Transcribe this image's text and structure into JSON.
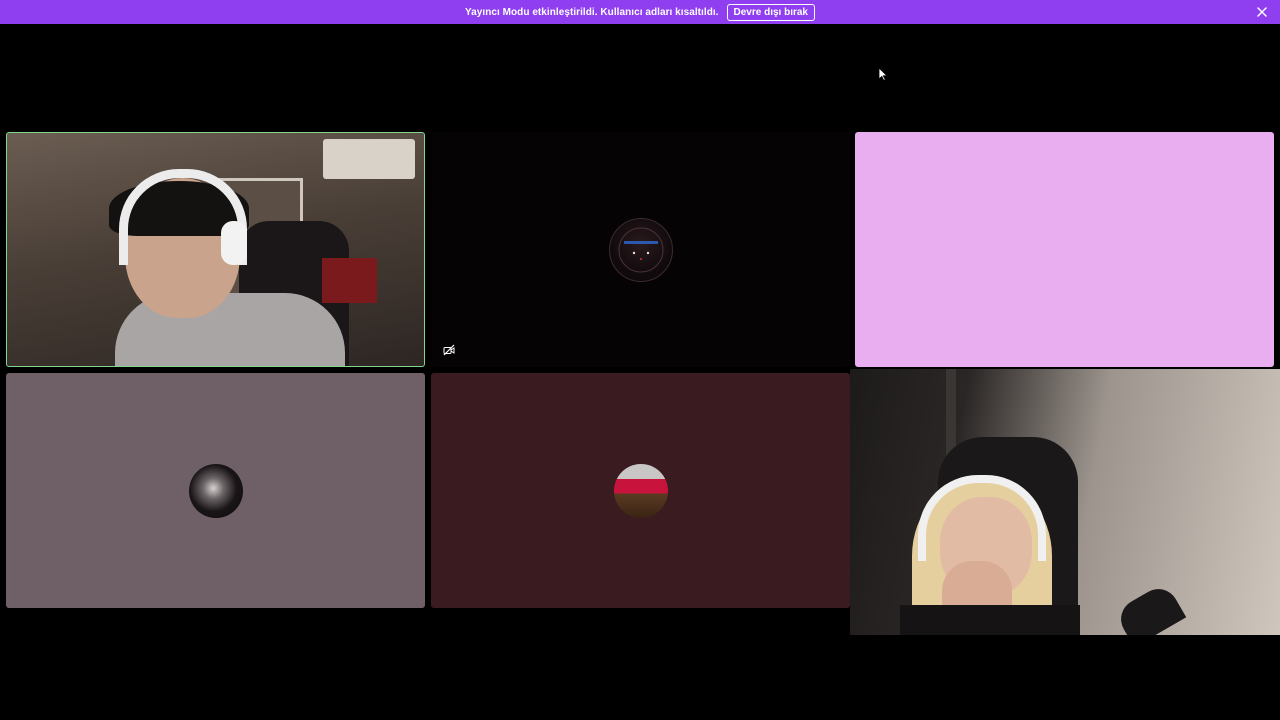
{
  "banner": {
    "message": "Yayıncı Modu etkinleştirildi. Kullanıcı adları kısaltıldı.",
    "disable_label": "Devre dışı bırak",
    "close_icon": "close-icon",
    "background_color": "#8f3ff0"
  },
  "tiles": [
    {
      "kind": "camera",
      "speaking": true,
      "highlight_color": "#7ed88c"
    },
    {
      "kind": "avatar",
      "camera_off_icon": "camera-off-icon",
      "background_color": "#050304"
    },
    {
      "kind": "color",
      "background_color": "#e8aef0"
    },
    {
      "kind": "avatar",
      "background_color": "#6f5f66"
    },
    {
      "kind": "avatar",
      "background_color": "#3a1b1f"
    },
    {
      "kind": "camera"
    }
  ]
}
